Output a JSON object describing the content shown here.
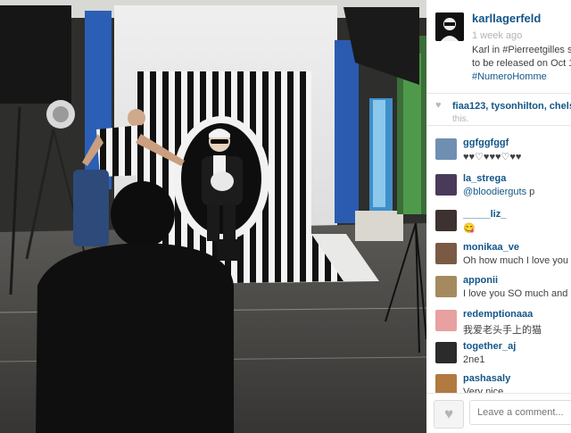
{
  "post": {
    "username": "karllagerfeld",
    "time": "1 week ago",
    "caption_lines": [
      "Karl in #Pierreetgilles s",
      "to be released on Oct 1",
      "#NumeroHomme"
    ]
  },
  "likes": {
    "users": "fiaa123, tysonhilton, chelse",
    "tail": "this."
  },
  "comments": [
    {
      "user": "ggfggfggf",
      "text": "♥♥♡♥♥♥♡♥♥",
      "avatar_color": "#6f8fb2"
    },
    {
      "user": "la_strega",
      "mention": "@bloodierguts",
      "text": " p",
      "avatar_color": "#4a3a5a"
    },
    {
      "user": "_____liz_",
      "text": "😋",
      "avatar_color": "#3d3230"
    },
    {
      "user": "monikaa_ve",
      "text": "Oh how much I love you",
      "avatar_color": "#7a5a44"
    },
    {
      "user": "apponii",
      "text": "I love you SO much and I",
      "avatar_color": "#a48a5e"
    },
    {
      "user": "redemptionaaa",
      "text": "我爱老头手上的猫",
      "avatar_color": "#e8a0a0"
    },
    {
      "user": "together_aj",
      "text": "2ne1",
      "avatar_color": "#2b2b2b"
    },
    {
      "user": "pashasaly",
      "text": "Very nice",
      "avatar_color": "#b07a40"
    }
  ],
  "footer": {
    "like_icon": "heart-icon",
    "comment_placeholder": "Leave a comment..."
  },
  "colors": {
    "link": "#125688",
    "meta": "#b3b3b3",
    "border": "#e6e6e6"
  }
}
